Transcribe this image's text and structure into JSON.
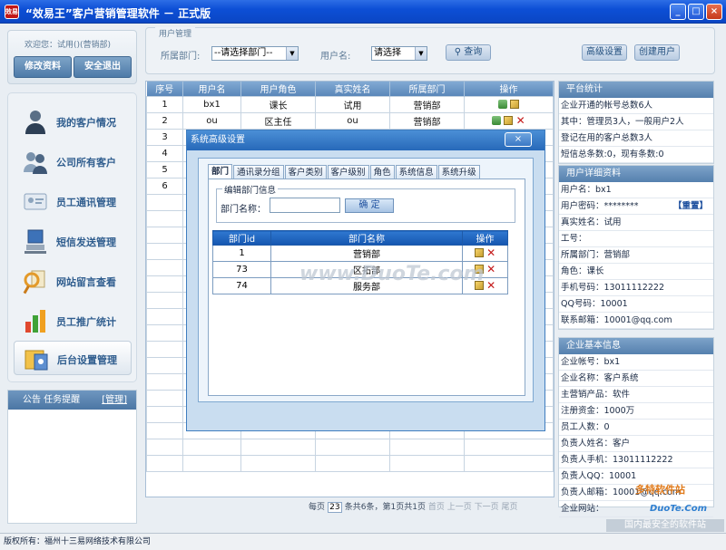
{
  "app": {
    "title": "“效易王”客户营销管理软件 － 正式版",
    "logo": "效易",
    "min": "_",
    "max": "□",
    "close": "×"
  },
  "user": {
    "welcome": "欢迎您：试用()(营销部)",
    "edit_label": "修改资料",
    "logout_label": "安全退出"
  },
  "menu": [
    {
      "label": "我的客户情况",
      "icon": "person-icon"
    },
    {
      "label": "公司所有客户",
      "icon": "people-icon"
    },
    {
      "label": "员工通讯管理",
      "icon": "contacts-card-icon"
    },
    {
      "label": "短信发送管理",
      "icon": "computer-icon"
    },
    {
      "label": "网站留言查看",
      "icon": "magnifier-note-icon"
    },
    {
      "label": "员工推广统计",
      "icon": "bar-chart-icon"
    },
    {
      "label": "后台设置管理",
      "icon": "settings-folder-icon"
    }
  ],
  "notice": {
    "title": "公告 任务提醒",
    "manage": "[管理]"
  },
  "filter": {
    "title": "用户管理",
    "dept_label": "所属部门:",
    "dept_value": "--请选择部门--",
    "user_label": "用户名:",
    "user_value": "请选择",
    "query": "查询",
    "advanced": "高级设置",
    "create": "创建用户"
  },
  "grid": {
    "headers": [
      "序号",
      "用户名",
      "用户角色",
      "真实姓名",
      "所属部门",
      "操作"
    ],
    "rows": [
      [
        "1",
        "bx1",
        "课长",
        "试用",
        "营销部"
      ],
      [
        "2",
        "ou",
        "区主任",
        "ou",
        "营销部"
      ],
      [
        "3",
        "",
        "",
        "",
        "",
        ""
      ],
      [
        "4",
        "",
        "",
        "",
        "",
        ""
      ],
      [
        "5",
        "",
        "",
        "",
        "",
        ""
      ],
      [
        "6",
        "",
        "",
        "",
        "",
        ""
      ]
    ]
  },
  "pager": {
    "per_page": "每页",
    "size": "23",
    "summary": "条共6条，第1页共1页",
    "first": "首页",
    "prev": "上一页",
    "next": "下一页",
    "last": "尾页"
  },
  "stats": {
    "title": "平台统计",
    "lines": [
      "企业开通的帐号总数6人",
      "其中：管理员3人，一般用户2人",
      "登记在用的客户总数3人",
      "短信总条数:0，现有条数:0"
    ]
  },
  "user_detail": {
    "title": "用户详细资料",
    "reset": "【重置】",
    "lines": [
      "用户名：bx1",
      "用户密码：********",
      "真实姓名：试用",
      "工号：",
      "所属部门：营销部",
      "角色：课长",
      "手机号码：13011112222",
      "QQ号码：10001",
      "联系邮箱：10001@qq.com"
    ]
  },
  "company": {
    "title": "企业基本信息",
    "lines": [
      "企业帐号：bx1",
      "企业名称：客户系统",
      "主营销产品：软件",
      "注册资金：1000万",
      "员工人数：0",
      "负责人姓名：客户",
      "负责人手机：13011112222",
      "负责人QQ：10001",
      "负责人邮箱：10001@qq.com",
      "企业网站："
    ]
  },
  "status": {
    "copyright": "版权所有：福州十三易网络技术有限公司"
  },
  "dialog": {
    "title": "系统高级设置",
    "close": "×",
    "tabs": [
      "部门",
      "通讯录分组",
      "客户类别",
      "客户级别",
      "角色",
      "系统信息",
      "系统升级"
    ],
    "fieldset": "编辑部门信息",
    "name_label": "部门名称：",
    "ok": "确 定",
    "headers": [
      "部门id",
      "部门名称",
      "操作"
    ],
    "rows": [
      {
        "id": "1",
        "name": "营销部"
      },
      {
        "id": "73",
        "name": "区拓部"
      },
      {
        "id": "74",
        "name": "服务部"
      }
    ]
  },
  "watermarks": {
    "duote": "www.DuoTe.com",
    "site_name": "多特软件站",
    "site_url": "DuoTe.Com",
    "slogan": "国内最安全的软件站"
  },
  "colors": {
    "accent": "#2769b9",
    "title_bar": "#0d4fd6",
    "danger": "#c41b1b"
  }
}
